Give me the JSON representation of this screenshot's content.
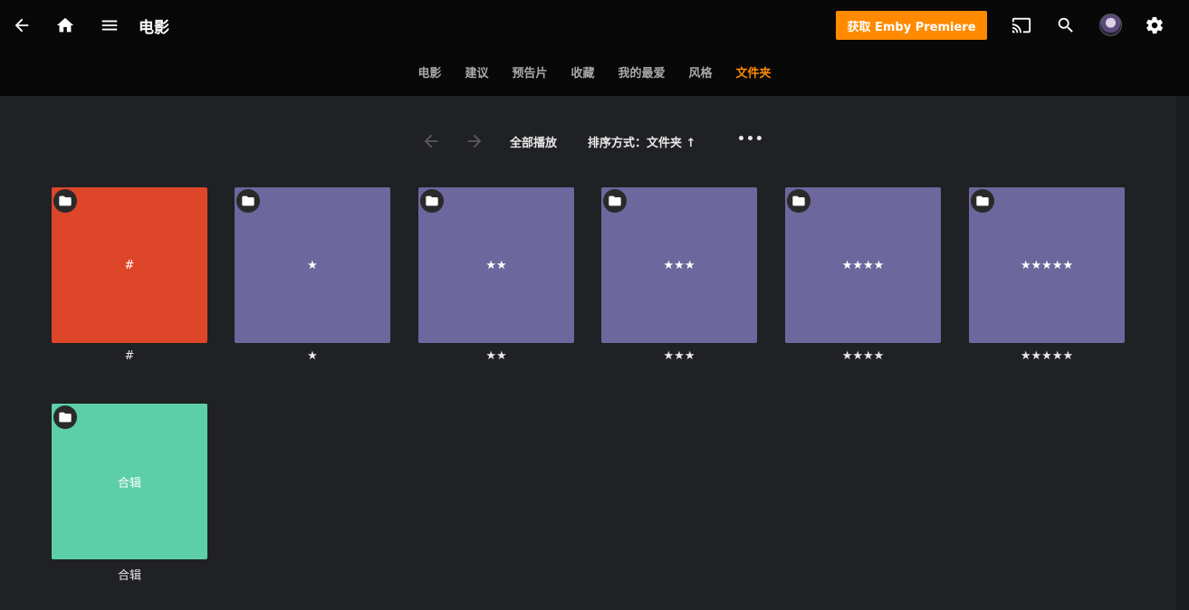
{
  "header": {
    "title": "电影",
    "premiere_label": "获取 Emby Premiere",
    "icons": {
      "back": "arrow-left-icon",
      "home": "home-icon",
      "menu": "menu-icon",
      "cast": "cast-icon",
      "search": "search-icon",
      "avatar": "user-avatar",
      "settings": "gear-icon"
    }
  },
  "tabs": [
    {
      "label": "电影",
      "active": false
    },
    {
      "label": "建议",
      "active": false
    },
    {
      "label": "预告片",
      "active": false
    },
    {
      "label": "收藏",
      "active": false
    },
    {
      "label": "我的最爱",
      "active": false
    },
    {
      "label": "风格",
      "active": false
    },
    {
      "label": "文件夹",
      "active": true
    }
  ],
  "toolbar": {
    "play_all": "全部播放",
    "sort": "排序方式：文件夹 ↑",
    "more": "•••"
  },
  "colors": {
    "accent": "#ff8a00",
    "folder_red": "#dd4629",
    "folder_purple": "#6c679c",
    "folder_green": "#5ccfa9"
  },
  "folders": [
    {
      "tile_text": "#",
      "caption": "#",
      "color": "#dd4629"
    },
    {
      "tile_text": "★",
      "caption": "★",
      "color": "#6c679c"
    },
    {
      "tile_text": "★★",
      "caption": "★★",
      "color": "#6c679c"
    },
    {
      "tile_text": "★★★",
      "caption": "★★★",
      "color": "#6c679c"
    },
    {
      "tile_text": "★★★★",
      "caption": "★★★★",
      "color": "#6c679c"
    },
    {
      "tile_text": "★★★★★",
      "caption": "★★★★★",
      "color": "#6c679c"
    },
    {
      "tile_text": "合辑",
      "caption": "合辑",
      "color": "#5ccfa9"
    }
  ]
}
